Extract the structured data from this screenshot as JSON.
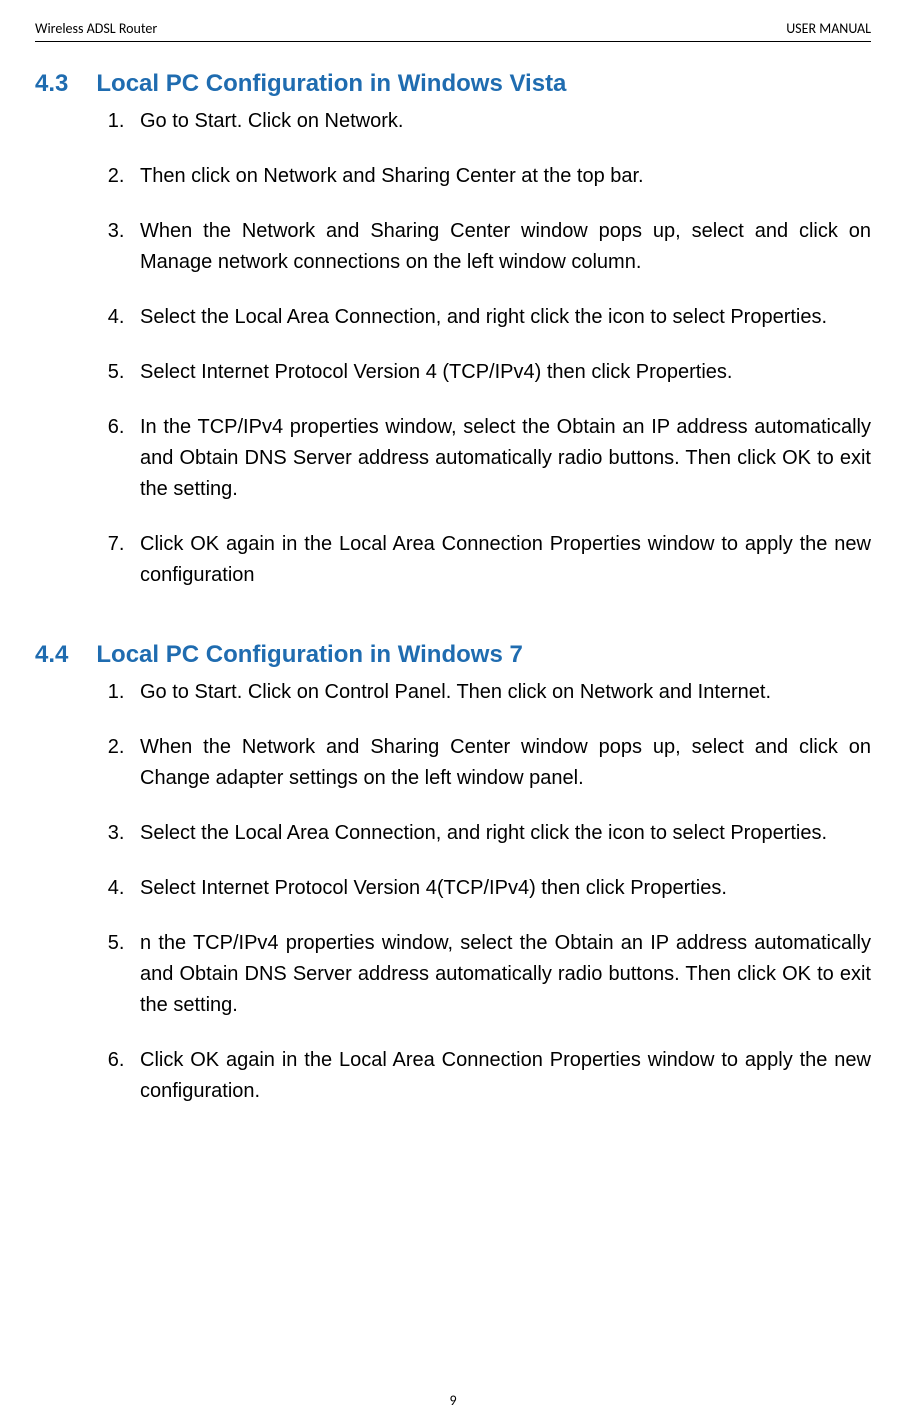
{
  "header": {
    "left": "Wireless ADSL Router",
    "right": "USER MANUAL"
  },
  "section1": {
    "number": "4.3",
    "title": "Local PC Configuration in Windows Vista",
    "items": [
      "Go to Start. Click on Network.",
      "Then click on Network and Sharing Center at the top bar.",
      "When the Network and Sharing Center window pops up, select and click on Manage network connections on the left window column.",
      "Select the Local Area Connection, and right click the icon to select Properties.",
      "Select Internet Protocol Version 4 (TCP/IPv4) then click Properties.",
      "In the TCP/IPv4 properties window, select the Obtain an IP address automatically and Obtain DNS Server address automatically radio buttons. Then click OK to exit the setting.",
      "Click OK again in the Local Area Connection Properties window to apply the new configuration"
    ]
  },
  "section2": {
    "number": "4.4",
    "title": "Local PC Configuration in Windows 7",
    "items": [
      "Go to Start. Click on Control Panel. Then click on Network and Internet.",
      "When the Network and Sharing Center window pops up, select and click on Change adapter settings on the left window panel.",
      "Select the Local Area Connection, and right click the icon to select Properties.",
      "Select Internet Protocol Version 4(TCP/IPv4) then click Properties.",
      "n the TCP/IPv4 properties window, select the Obtain an IP address automatically and Obtain DNS Server address automatically radio buttons. Then click OK to exit the setting.",
      "Click OK again in the Local Area Connection Properties window to apply the new configuration."
    ]
  },
  "pageNumber": "9"
}
